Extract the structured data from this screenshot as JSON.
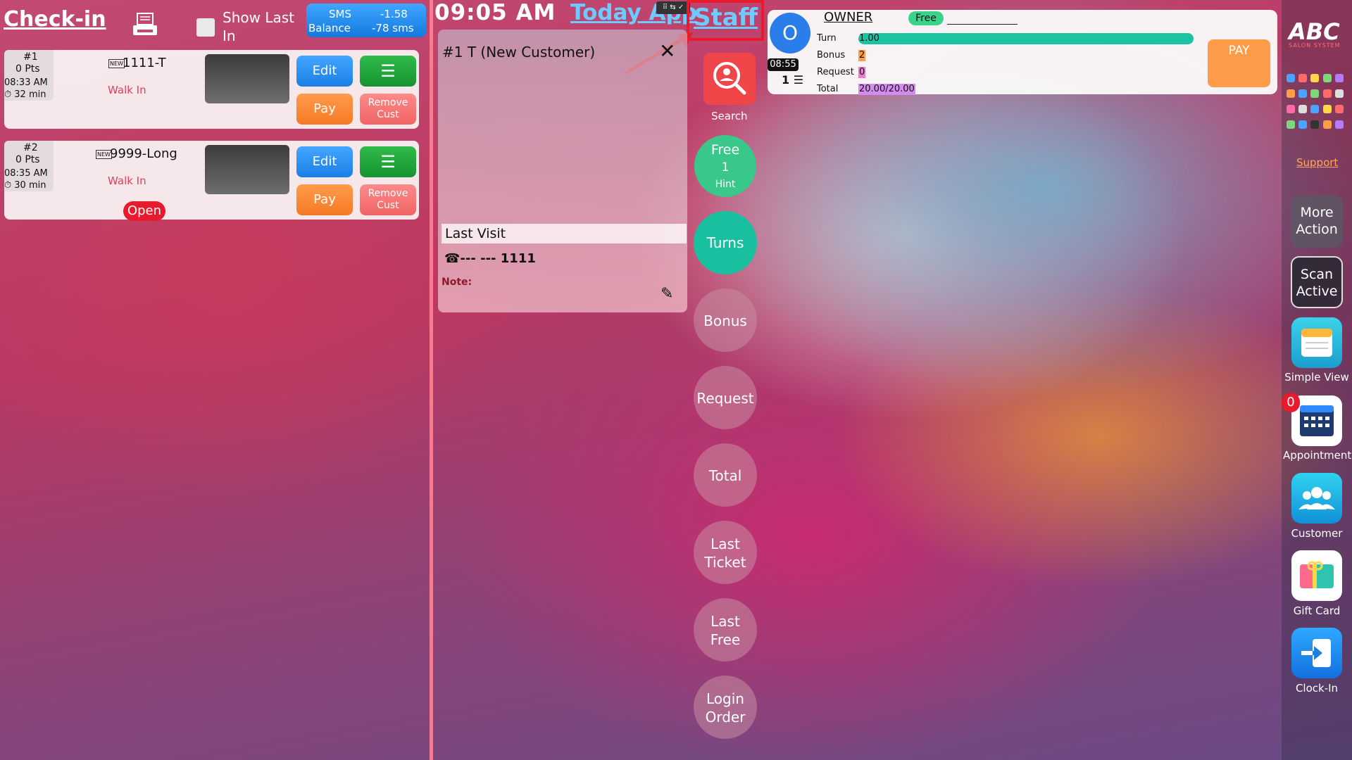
{
  "header": {
    "checkin_title": "Check-in",
    "show_last_in": "Show Last In",
    "sms": {
      "label1": "SMS",
      "label2": "Balance",
      "balance": "-1.58",
      "sms_count": "-78 sms"
    },
    "clock": "09:05 AM",
    "today_app": "Today App",
    "staff_link": "Staff"
  },
  "customers": [
    {
      "number": "#1",
      "points": "0 Pts",
      "time": "08:33 AM",
      "duration": "32 min",
      "new_tag": "NEW",
      "name": "1111-T",
      "status": "Walk In",
      "edit": "Edit",
      "menu": "☰",
      "pay": "Pay",
      "remove": "Remove Cust"
    },
    {
      "number": "#2",
      "points": "0 Pts",
      "time": "08:35 AM",
      "duration": "30 min",
      "new_tag": "NEW",
      "name": "9999-Long",
      "status": "Walk In",
      "edit": "Edit",
      "menu": "☰",
      "pay": "Pay",
      "remove": "Remove Cust",
      "badge": "Open"
    }
  ],
  "middle_panel": {
    "title": "#1 T (New Customer)",
    "close": "✕",
    "last_visit": "Last Visit",
    "phone": "☎--- --- 1111",
    "note_label": "Note:",
    "note_edit": "✎"
  },
  "actions": {
    "search": "Search",
    "free_line1": "Free",
    "free_line2": "1",
    "free_line3": "Hint",
    "turns": "Turns",
    "bonus": "Bonus",
    "request": "Request",
    "total": "Total",
    "last_ticket": "Last Ticket",
    "last_free": "Last Free",
    "login_order": "Login Order"
  },
  "staff": {
    "avatar_initial": "O",
    "time": "08:55",
    "count": "1 ☰",
    "name": "OWNER",
    "status_pill": "Free",
    "turn_label": "Turn",
    "turn_value": "1.00",
    "bonus_label": "Bonus",
    "bonus_value": "2",
    "request_label": "Request",
    "request_value": "0",
    "total_label": "Total",
    "total_value": "20.00/20.00",
    "pay": "PAY"
  },
  "dock": {
    "logo": "ABC",
    "logo_sub": "SALON SYSTEM",
    "support": "Support",
    "more_action": "More Action",
    "scan_active": "Scan Active",
    "simple_view": "Simple View",
    "appointment_count": "0",
    "appointment": "Appointment",
    "customer": "Customer",
    "gift_card": "Gift Card",
    "clock_in": "Clock-In"
  },
  "colors": {
    "edit_blue": "#1b7fe4",
    "menu_green": "#179331",
    "pay_orange": "#f57a25",
    "remove_red": "#f06464",
    "open_red": "#e81a2e",
    "link_blue": "#6ecbff",
    "turns_teal": "#18c0a0",
    "free_green": "#39c88a"
  }
}
